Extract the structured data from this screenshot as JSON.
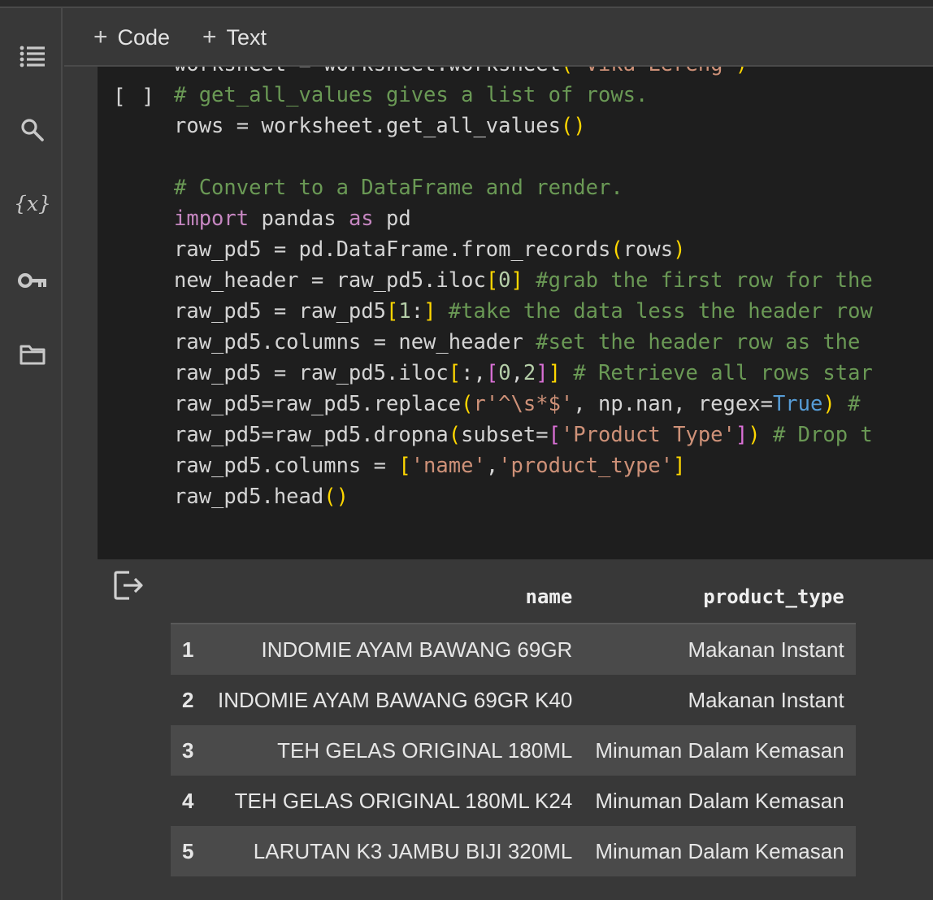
{
  "toolbar": {
    "code_label": "Code",
    "text_label": "Text",
    "plus": "+"
  },
  "sidebar": {
    "items": [
      {
        "name": "table-of-contents",
        "icon": "list-icon"
      },
      {
        "name": "search",
        "icon": "search-icon"
      },
      {
        "name": "variables",
        "icon": "variables-icon",
        "glyph": "{x}"
      },
      {
        "name": "secrets",
        "icon": "key-icon"
      },
      {
        "name": "files",
        "icon": "folder-icon"
      }
    ]
  },
  "cell": {
    "run_label": "[ ]",
    "code_lines": [
      "worksheet = worksheet.worksheet('Vika Lereng')",
      "# get_all_values gives a list of rows.",
      "rows = worksheet.get_all_values()",
      "",
      "# Convert to a DataFrame and render.",
      "import pandas as pd",
      "raw_pd5 = pd.DataFrame.from_records(rows)",
      "new_header = raw_pd5.iloc[0] #grab the first row for the",
      "raw_pd5 = raw_pd5[1:] #take the data less the header row",
      "raw_pd5.columns = new_header #set the header row as the",
      "raw_pd5 = raw_pd5.iloc[:,[0,2]] # Retrieve all rows star",
      "raw_pd5=raw_pd5.replace(r'^\\s*$', np.nan, regex=True) #",
      "raw_pd5=raw_pd5.dropna(subset=['Product Type']) # Drop t",
      "raw_pd5.columns = ['name','product_type']",
      "raw_pd5.head()"
    ]
  },
  "output": {
    "icon": "output-icon",
    "columns": [
      "",
      "name",
      "product_type"
    ],
    "rows": [
      {
        "index": "1",
        "name": "INDOMIE AYAM BAWANG 69GR",
        "product_type": "Makanan Instant"
      },
      {
        "index": "2",
        "name": "INDOMIE AYAM BAWANG 69GR K40",
        "product_type": "Makanan Instant"
      },
      {
        "index": "3",
        "name": "TEH GELAS ORIGINAL 180ML",
        "product_type": "Minuman Dalam Kemasan"
      },
      {
        "index": "4",
        "name": "TEH GELAS ORIGINAL 180ML K24",
        "product_type": "Minuman Dalam Kemasan"
      },
      {
        "index": "5",
        "name": "LARUTAN K3 JAMBU BIJI 320ML",
        "product_type": "Minuman Dalam Kemasan"
      }
    ]
  },
  "colors": {
    "background": "#383838",
    "editor": "#1e1e1e",
    "comment": "#6a9955",
    "keyword": "#c586c0",
    "string": "#ce9178",
    "number": "#b5cea8",
    "boolean": "#569cd6",
    "bracket": "#ffd700"
  }
}
